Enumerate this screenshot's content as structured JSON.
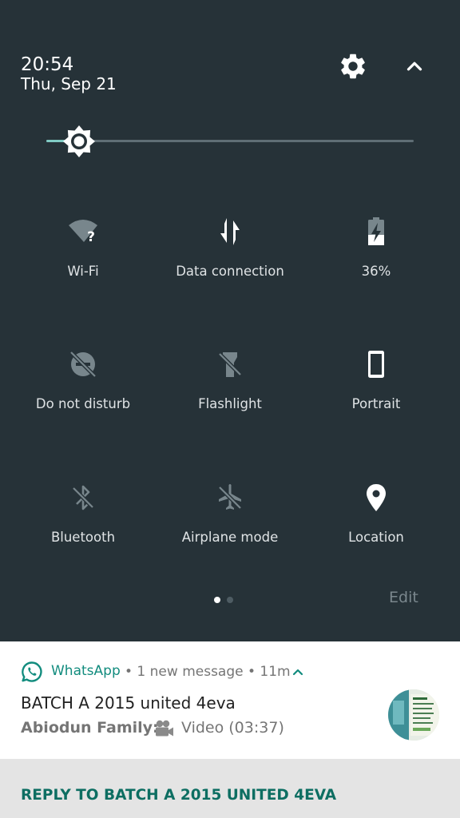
{
  "status": {
    "time": "20:54",
    "date": "Thu, Sep 21"
  },
  "header_icons": {
    "settings": "gear-icon",
    "collapse": "chevron-up-icon"
  },
  "brightness": {
    "level": 0.09,
    "icon": "brightness-icon"
  },
  "tiles": [
    {
      "label": "Wi-Fi",
      "icon": "wifi-unknown-icon",
      "active": false
    },
    {
      "label": "Data connection",
      "icon": "data-arrows-icon",
      "active": true
    },
    {
      "label": "36%",
      "icon": "battery-charging-icon",
      "active": false
    },
    {
      "label": "Do not disturb",
      "icon": "dnd-off-icon",
      "active": false
    },
    {
      "label": "Flashlight",
      "icon": "flashlight-off-icon",
      "active": false
    },
    {
      "label": "Portrait",
      "icon": "portrait-icon",
      "active": true
    },
    {
      "label": "Bluetooth",
      "icon": "bluetooth-off-icon",
      "active": false
    },
    {
      "label": "Airplane mode",
      "icon": "airplane-off-icon",
      "active": false
    },
    {
      "label": "Location",
      "icon": "location-icon",
      "active": true
    }
  ],
  "pager": {
    "pages": 2,
    "current": 1
  },
  "edit_label": "Edit",
  "notification": {
    "app": "WhatsApp",
    "meta": "• 1 new message • 11m",
    "title": "BATCH A 2015 united 4eva",
    "sender": "Abiodun Family:",
    "body": "Video (03:37)",
    "action": "REPLY TO BATCH A 2015 UNITED 4EVA"
  },
  "colors": {
    "shade_bg": "#263238",
    "accent": "#80cbc4",
    "whatsapp": "#128c7e",
    "reply": "#0d6e62"
  }
}
